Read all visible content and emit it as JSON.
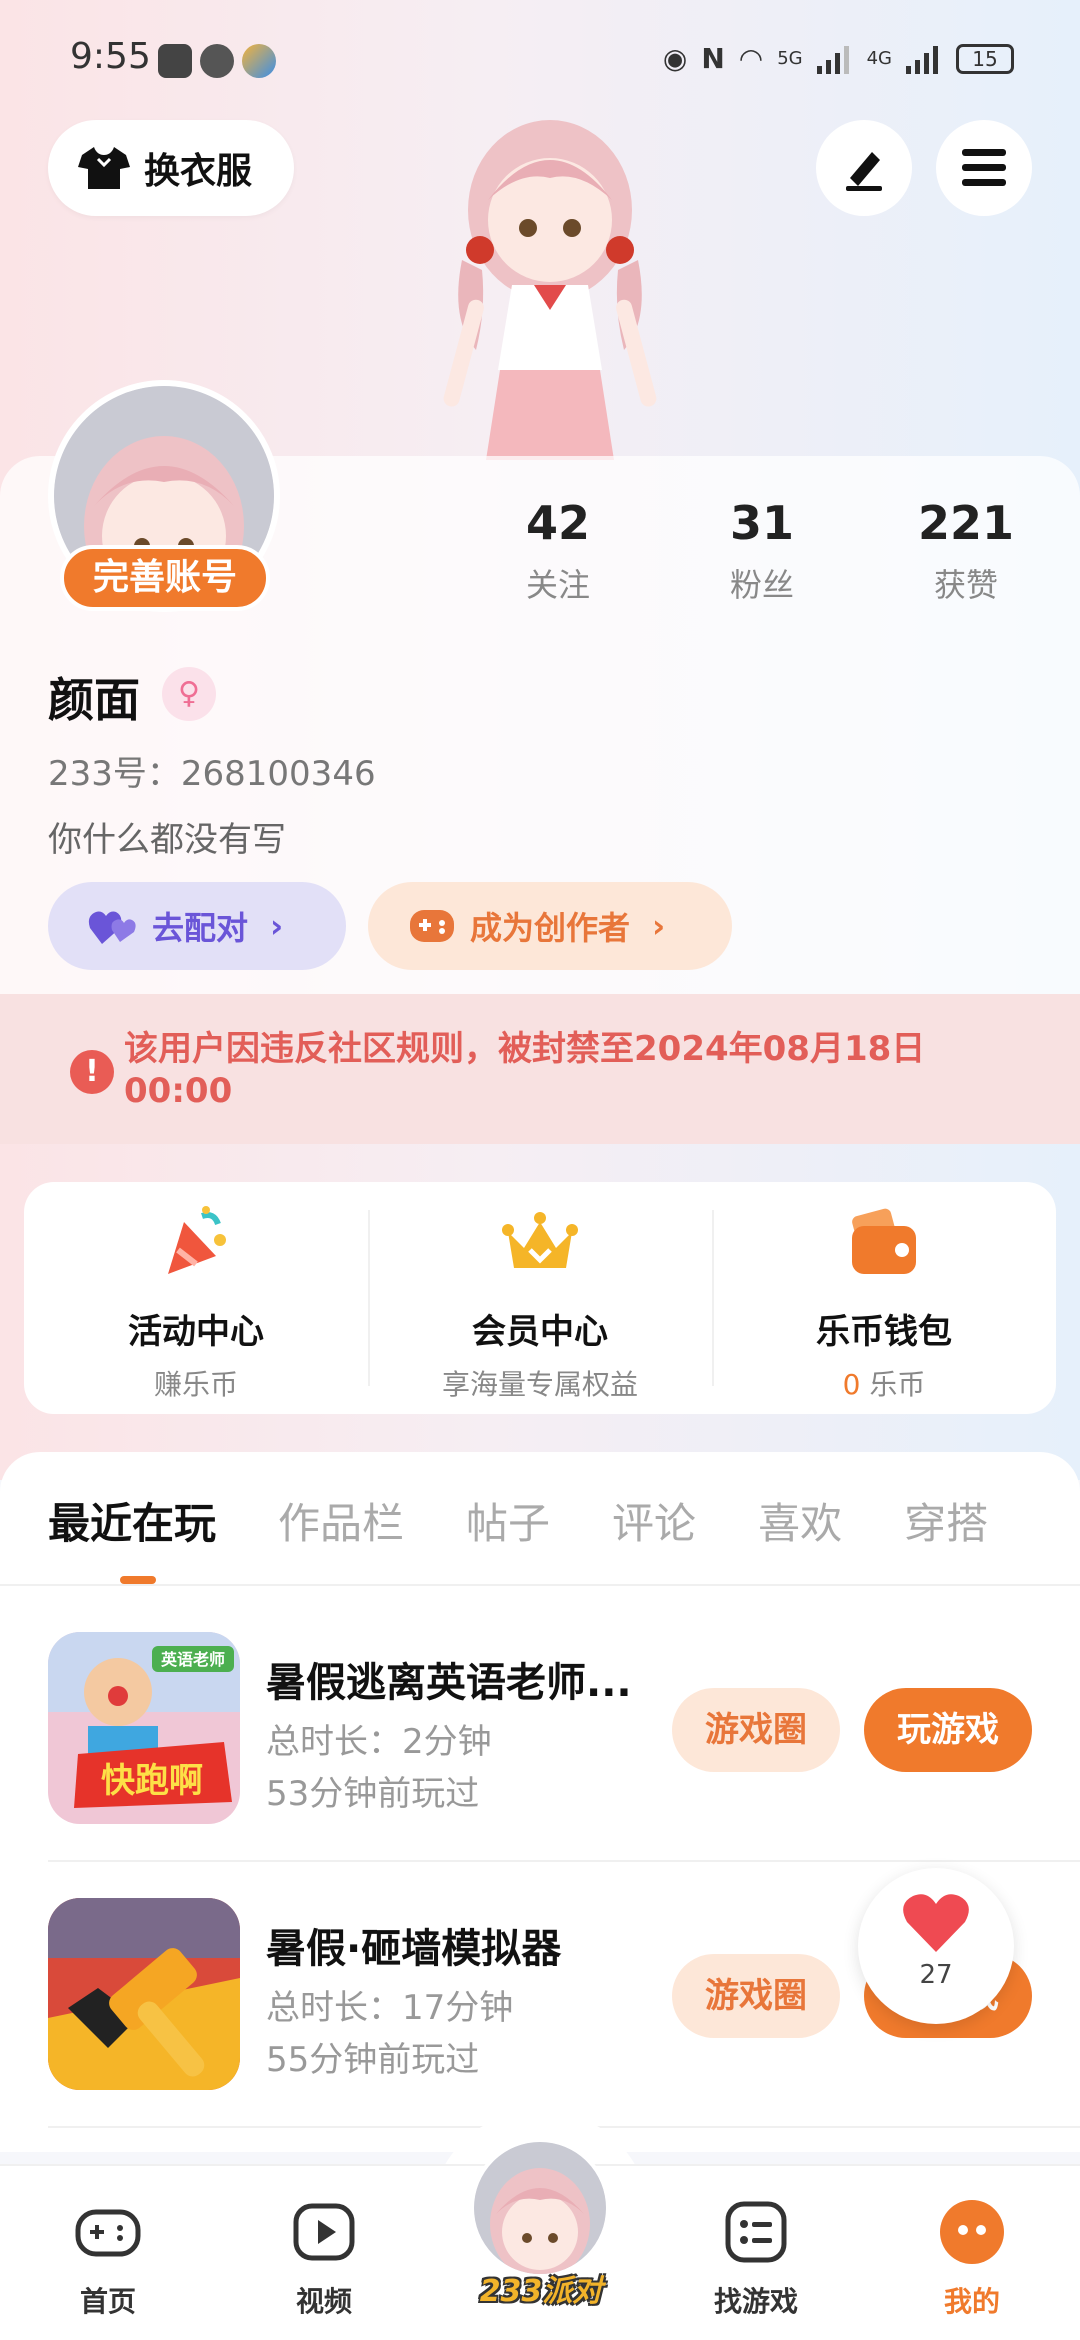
{
  "status_bar": {
    "time": "9:55",
    "battery": "15",
    "network_1": "5G",
    "network_2": "4G"
  },
  "top": {
    "outfit_label": "换衣服"
  },
  "profile": {
    "complete_label": "完善账号",
    "stats": [
      {
        "num": "42",
        "label": "关注"
      },
      {
        "num": "31",
        "label": "粉丝"
      },
      {
        "num": "221",
        "label": "获赞"
      }
    ],
    "username": "颜面",
    "gender_symbol": "♀",
    "uid": "233号：268100346",
    "bio": "你什么都没有写",
    "match_label": "去配对",
    "creator_label": "成为创作者"
  },
  "ban_notice": {
    "text": "该用户因违反社区规则，被封禁至2024年08月18日 00:00"
  },
  "centers": [
    {
      "title": "活动中心",
      "sub": "赚乐币",
      "icon": "party-popper-icon"
    },
    {
      "title": "会员中心",
      "sub": "享海量专属权益",
      "icon": "crown-icon"
    },
    {
      "title": "乐币钱包",
      "sub_num": "0",
      "sub_unit": " 乐币",
      "icon": "wallet-icon"
    }
  ],
  "tabs": [
    "最近在玩",
    "作品栏",
    "帖子",
    "评论",
    "喜欢",
    "穿搭"
  ],
  "games": [
    {
      "title": "暑假逃离英语老师...",
      "duration": "总时长：2分钟",
      "last_played": "53分钟前玩过",
      "thumb_tag": "英语老师",
      "thumb_text": "快跑啊",
      "circle_label": "游戏圈",
      "play_label": "玩游戏"
    },
    {
      "title": "暑假·砸墙模拟器",
      "duration": "总时长：17分钟",
      "last_played": "55分钟前玩过",
      "circle_label": "游戏圈",
      "play_label": "玩游戏"
    }
  ],
  "like_float": {
    "count": "27"
  },
  "bottom_nav": {
    "home": "首页",
    "video": "视频",
    "party": "233派对",
    "find": "找游戏",
    "mine": "我的"
  },
  "colors": {
    "accent": "#f07a2c",
    "ban_text": "#e25e58",
    "match": "#6a55d8"
  }
}
